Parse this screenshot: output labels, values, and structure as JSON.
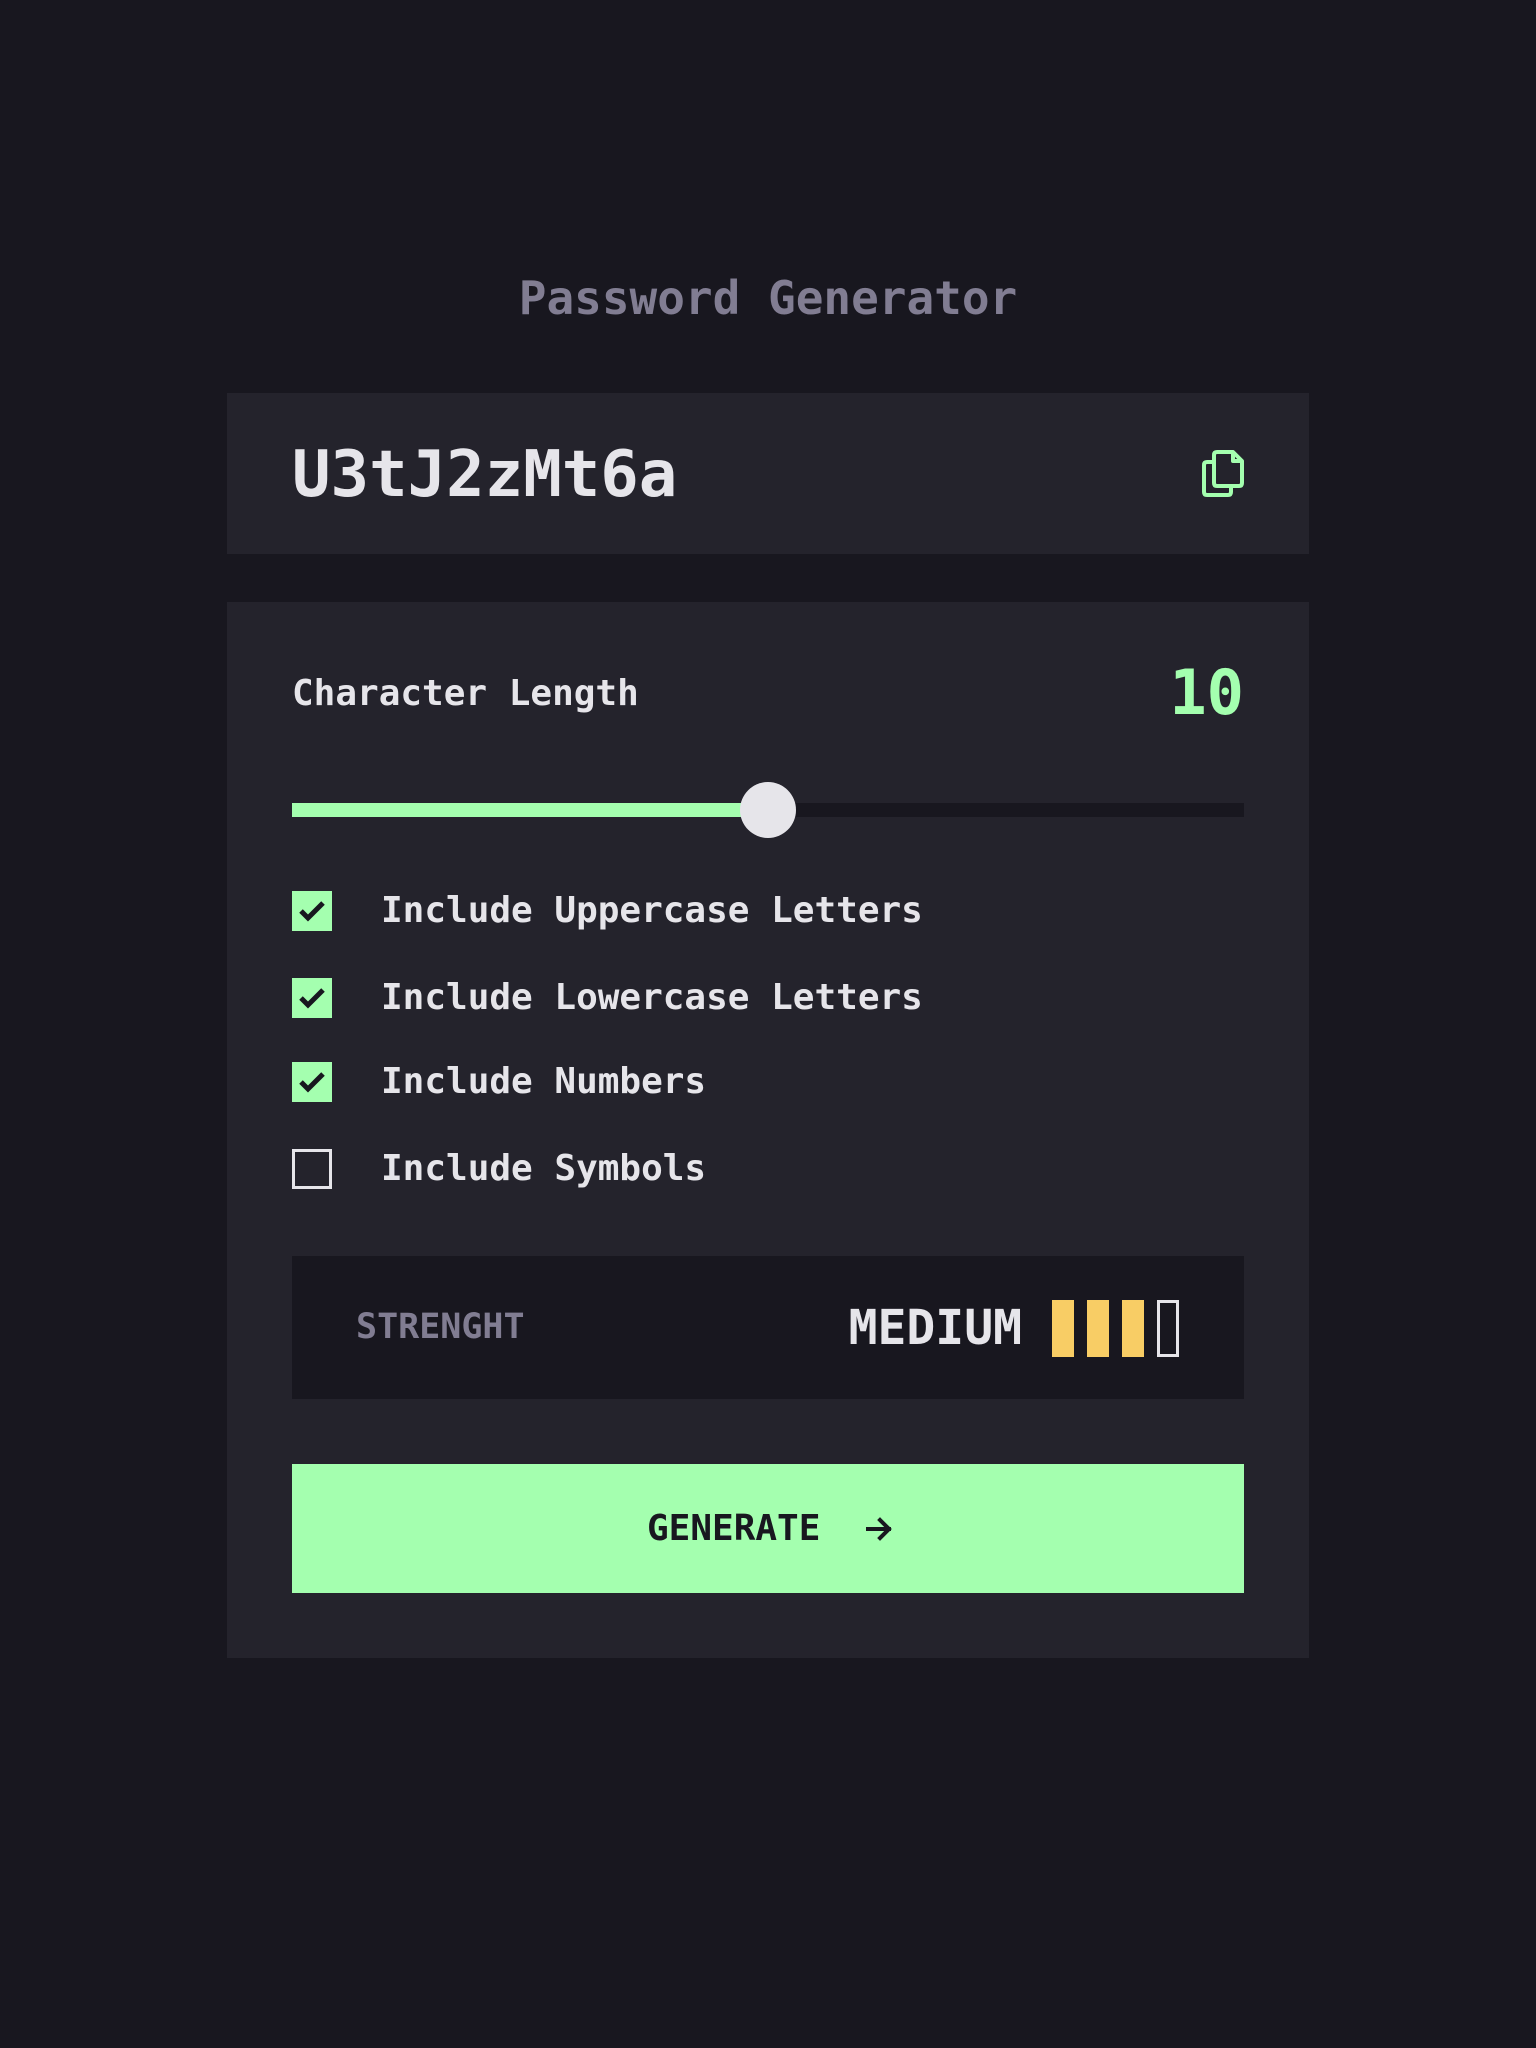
{
  "app": {
    "title": "Password Generator"
  },
  "password": {
    "value": "U3tJ2zMt6a",
    "copy_icon": "copy-icon"
  },
  "length": {
    "label": "Character Length",
    "value": "10",
    "slider_fraction": 0.5
  },
  "options": [
    {
      "label": "Include Uppercase Letters",
      "checked": true
    },
    {
      "label": "Include Lowercase Letters",
      "checked": true
    },
    {
      "label": "Include Numbers",
      "checked": true
    },
    {
      "label": "Include Symbols",
      "checked": false
    }
  ],
  "strength": {
    "label": "STRENGHT",
    "value": "MEDIUM",
    "bars_filled": 3,
    "bars_total": 4
  },
  "generate": {
    "label": "GENERATE",
    "icon": "arrow-right-icon"
  },
  "colors": {
    "background": "#18171f",
    "panel": "#24232c",
    "accent": "#a4ffaf",
    "text": "#e6e5ea",
    "muted": "#817d92",
    "strength_medium": "#f8cd65"
  }
}
